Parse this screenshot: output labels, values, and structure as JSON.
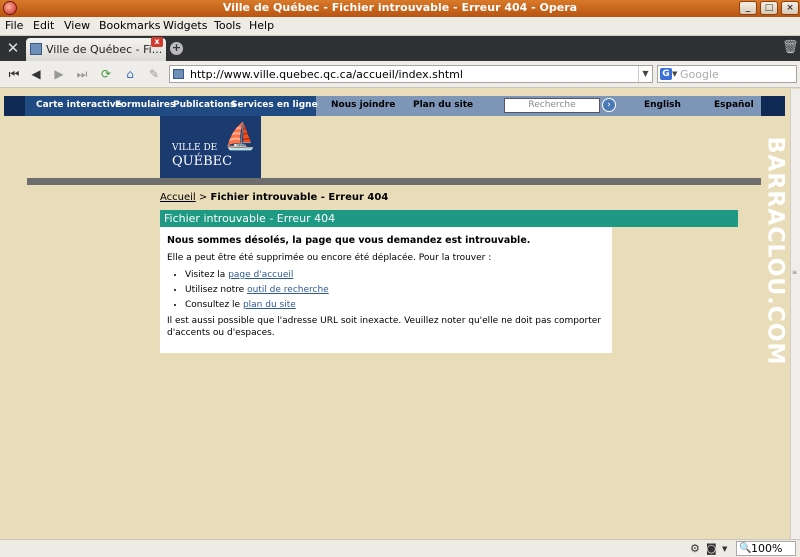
{
  "window": {
    "title": "Ville de Québec - Fichier introuvable - Erreur 404 - Opera",
    "controls": [
      "minimize",
      "maximize",
      "close"
    ]
  },
  "menu": [
    "File",
    "Edit",
    "View",
    "Bookmarks",
    "Widgets",
    "Tools",
    "Help"
  ],
  "tabs": [
    {
      "label": "Ville de Québec - Fi...",
      "close": "x"
    }
  ],
  "toolbar": {
    "url": "http://www.ville.quebec.qc.ca/accueil/index.shtml",
    "search_placeholder": "Google",
    "search_engine_letter": "G"
  },
  "site": {
    "nav": [
      "Carte interactive",
      "Formulaires",
      "Publications",
      "Services en ligne"
    ],
    "nav2": [
      "Nous joindre",
      "Plan du site"
    ],
    "search_placeholder": "Recherche",
    "langs": [
      "English",
      "Español"
    ],
    "logo": {
      "line1": "VILLE DE",
      "line2": "QUÉBEC"
    }
  },
  "breadcrumb": {
    "home": "Accueil",
    "sep": ">",
    "current": "Fichier introuvable - Erreur 404"
  },
  "error": {
    "heading": "Fichier introuvable - Erreur 404",
    "lead": "Nous sommes désolés, la page que vous demandez est introuvable.",
    "intro": "Elle a peut être été supprimée ou encore été déplacée. Pour la trouver :",
    "items": [
      {
        "prefix": "Visitez la ",
        "link": "page d'accueil"
      },
      {
        "prefix": "Utilisez notre ",
        "link": "outil de recherche"
      },
      {
        "prefix": "Consultez le ",
        "link": "plan du site"
      }
    ],
    "footer": "Il est aussi possible que l'adresse URL soit inexacte. Veuillez noter qu'elle ne doit pas comporter d'accents ou d'espaces."
  },
  "watermark": "BARRACLOU.COM",
  "status": {
    "zoom": "100%"
  }
}
